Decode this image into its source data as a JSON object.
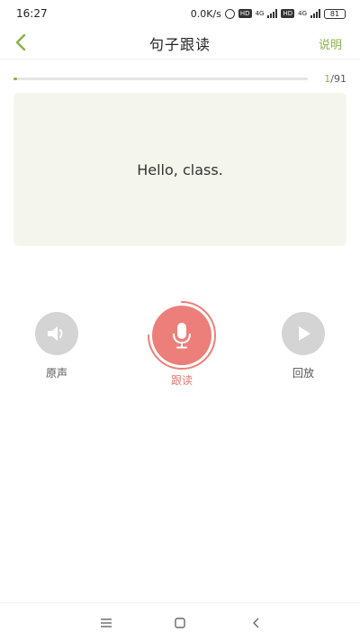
{
  "status_bar": {
    "time": "16:27",
    "net_speed": "0.0K/s",
    "chip_1": "HD",
    "net_1": "4G",
    "chip_2": "HD",
    "net_2": "4G",
    "battery": "81"
  },
  "header": {
    "title": "句子跟读",
    "help_label": "说明",
    "back_icon": "chevron-left-icon"
  },
  "progress": {
    "current": "1",
    "total": "/91",
    "fraction": 0.011
  },
  "sentence": {
    "text": "Hello, class."
  },
  "controls": {
    "original_label": "原声",
    "read_label": "跟读",
    "playback_label": "回放",
    "original_icon": "speaker-icon",
    "read_icon": "microphone-icon",
    "playback_icon": "play-icon"
  },
  "nav": {
    "menu_icon": "menu-icon",
    "home_icon": "home-icon",
    "back_icon": "back-icon"
  },
  "colors": {
    "accent": "#8cb34a",
    "record": "#ec7f7a",
    "card": "#f4f6ee"
  }
}
